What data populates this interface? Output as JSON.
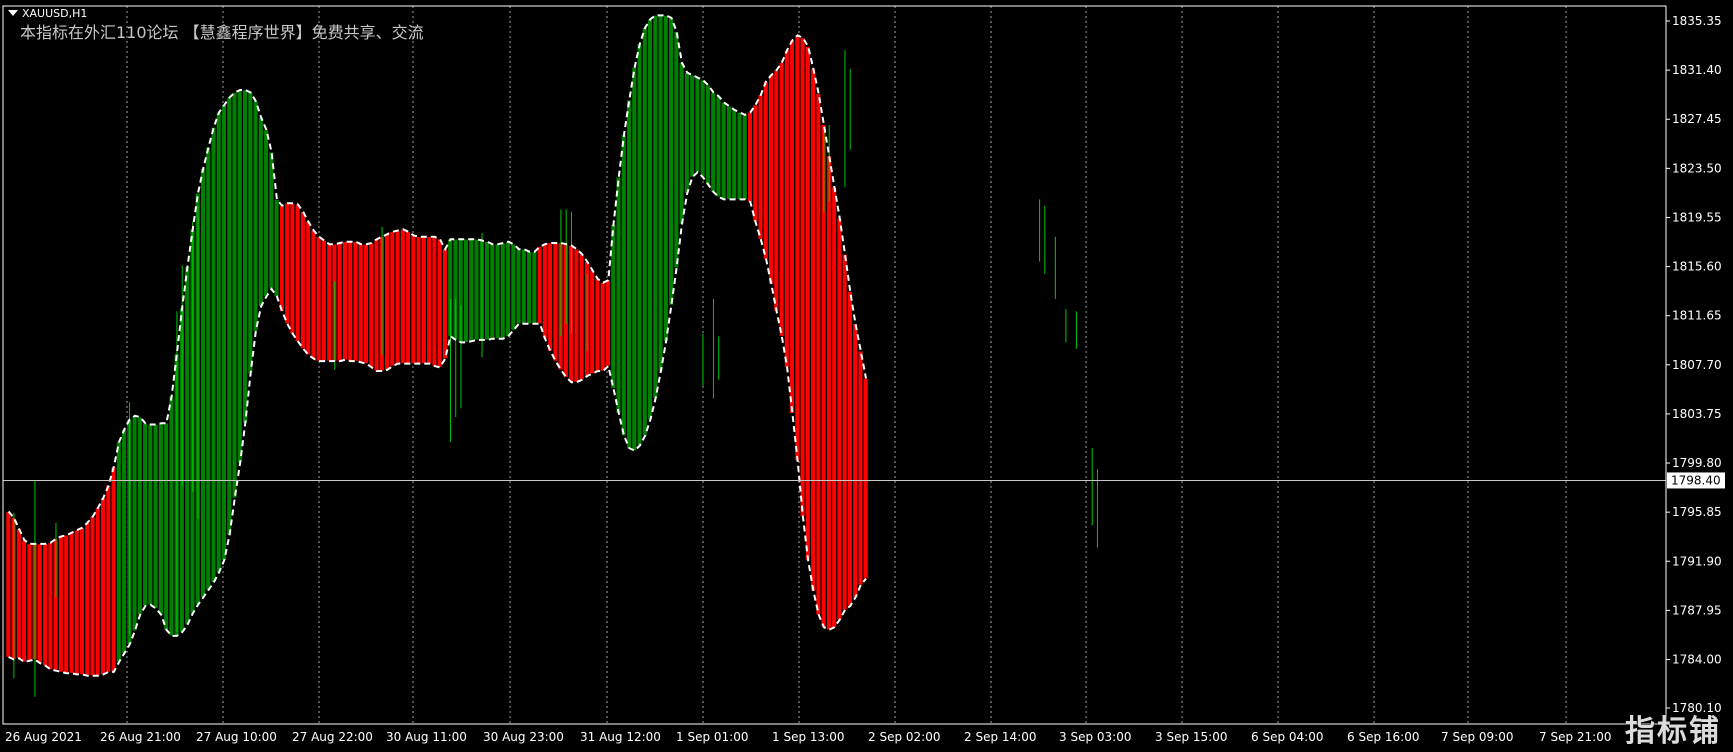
{
  "header": {
    "symbol_label": "XAUUSD,H1",
    "indicator_note": "本指标在外汇110论坛 【慧鑫程序世界】免费共享、交流"
  },
  "watermark": "指标铺",
  "colors": {
    "background": "#000000",
    "axis": "#ffffff",
    "grid": "#c8c8c8",
    "up": "#008000",
    "down": "#ff0000",
    "wick": "#00c800",
    "band_edge": "#ffffff"
  },
  "chart_data": {
    "type": "bar",
    "description_series": "colored band between upper and lower envelope per hourly bar",
    "price_axis": {
      "ticks": [
        "1835.35",
        "1831.40",
        "1827.45",
        "1823.50",
        "1819.55",
        "1815.60",
        "1811.65",
        "1807.70",
        "1803.75",
        "1799.80",
        "1795.85",
        "1791.90",
        "1787.95",
        "1784.00",
        "1780.10"
      ],
      "ylim": [
        1780.1,
        1835.35
      ],
      "current_price": "1798.40"
    },
    "time_axis": {
      "ticks": [
        "26 Aug 2021",
        "26 Aug 21:00",
        "27 Aug 10:00",
        "27 Aug 22:00",
        "30 Aug 11:00",
        "30 Aug 23:00",
        "31 Aug 12:00",
        "1 Sep 01:00",
        "1 Sep 13:00",
        "2 Sep 02:00",
        "2 Sep 14:00",
        "3 Sep 03:00",
        "3 Sep 15:00",
        "6 Sep 04:00",
        "6 Sep 16:00",
        "7 Sep 09:00",
        "7 Sep 21:00"
      ]
    },
    "grid": "vertical-dotted",
    "segments": [
      {
        "color": "down",
        "bars": [
          [
            1795.9,
            1784.2
          ],
          [
            1795.4,
            1784.0
          ],
          [
            1794.5,
            1784.1
          ],
          [
            1793.6,
            1783.8
          ],
          [
            1793.3,
            1783.9
          ],
          [
            1793.3,
            1784.0
          ],
          [
            1793.3,
            1783.7
          ],
          [
            1793.3,
            1783.5
          ],
          [
            1793.4,
            1783.2
          ],
          [
            1793.7,
            1783.1
          ],
          [
            1793.9,
            1783.0
          ],
          [
            1794.0,
            1782.9
          ],
          [
            1794.2,
            1782.9
          ],
          [
            1794.4,
            1782.8
          ],
          [
            1794.6,
            1782.8
          ],
          [
            1795.0,
            1782.7
          ],
          [
            1795.5,
            1782.7
          ],
          [
            1796.2,
            1782.7
          ],
          [
            1797.0,
            1782.8
          ],
          [
            1798.0,
            1783.0
          ],
          [
            1799.5,
            1783.0
          ]
        ]
      },
      {
        "color": "up",
        "bars": [
          [
            1801.5,
            1783.8
          ],
          [
            1802.5,
            1784.5
          ],
          [
            1803.3,
            1785.2
          ],
          [
            1803.6,
            1786.3
          ],
          [
            1803.5,
            1787.6
          ],
          [
            1803.0,
            1788.3
          ],
          [
            1802.9,
            1788.4
          ],
          [
            1802.9,
            1788.1
          ],
          [
            1803.0,
            1787.6
          ],
          [
            1803.0,
            1786.4
          ],
          [
            1805.2,
            1785.9
          ],
          [
            1808.6,
            1785.9
          ],
          [
            1812.3,
            1786.2
          ],
          [
            1815.6,
            1786.8
          ],
          [
            1818.6,
            1787.7
          ],
          [
            1821.5,
            1788.4
          ],
          [
            1823.5,
            1789.0
          ],
          [
            1825.2,
            1789.6
          ],
          [
            1826.8,
            1790.2
          ],
          [
            1828.0,
            1791.0
          ],
          [
            1828.6,
            1792.0
          ],
          [
            1829.2,
            1794.0
          ],
          [
            1829.6,
            1797.0
          ],
          [
            1829.8,
            1799.8
          ],
          [
            1829.8,
            1803.0
          ],
          [
            1829.6,
            1807.0
          ],
          [
            1828.9,
            1810.4
          ],
          [
            1827.6,
            1812.4
          ],
          [
            1826.6,
            1813.2
          ],
          [
            1824.8,
            1813.8
          ],
          [
            1821.0,
            1813.2
          ]
        ]
      },
      {
        "color": "down",
        "bars": [
          [
            1820.5,
            1812.0
          ],
          [
            1820.7,
            1811.0
          ],
          [
            1820.7,
            1810.2
          ],
          [
            1820.6,
            1809.6
          ],
          [
            1820.0,
            1809.0
          ],
          [
            1819.2,
            1808.5
          ],
          [
            1818.5,
            1808.2
          ],
          [
            1818.0,
            1808.0
          ],
          [
            1817.7,
            1808.0
          ],
          [
            1817.4,
            1808.0
          ],
          [
            1817.4,
            1808.0
          ],
          [
            1817.5,
            1808.0
          ],
          [
            1817.6,
            1808.1
          ],
          [
            1817.6,
            1808.0
          ],
          [
            1817.6,
            1808.0
          ],
          [
            1817.4,
            1807.9
          ],
          [
            1817.4,
            1807.8
          ],
          [
            1817.5,
            1807.5
          ],
          [
            1817.8,
            1807.2
          ],
          [
            1818.0,
            1807.2
          ],
          [
            1818.2,
            1807.3
          ],
          [
            1818.4,
            1807.6
          ],
          [
            1818.5,
            1807.8
          ],
          [
            1818.6,
            1807.8
          ],
          [
            1818.4,
            1807.8
          ],
          [
            1818.1,
            1807.8
          ],
          [
            1818.0,
            1807.8
          ],
          [
            1818.0,
            1807.8
          ],
          [
            1818.0,
            1807.8
          ],
          [
            1818.0,
            1807.6
          ],
          [
            1817.8,
            1807.5
          ],
          [
            1817.0,
            1808.2
          ]
        ]
      },
      {
        "color": "up",
        "bars": [
          [
            1817.8,
            1810.0
          ],
          [
            1817.8,
            1809.7
          ],
          [
            1817.8,
            1809.5
          ],
          [
            1817.8,
            1809.5
          ],
          [
            1817.8,
            1809.6
          ],
          [
            1817.8,
            1809.7
          ],
          [
            1817.7,
            1809.7
          ],
          [
            1817.6,
            1809.7
          ],
          [
            1817.4,
            1809.8
          ],
          [
            1817.4,
            1809.8
          ],
          [
            1817.5,
            1809.8
          ],
          [
            1817.6,
            1810.0
          ],
          [
            1817.4,
            1810.5
          ],
          [
            1817.0,
            1811.0
          ],
          [
            1817.0,
            1811.0
          ],
          [
            1816.8,
            1811.0
          ],
          [
            1816.8,
            1811.0
          ]
        ]
      },
      {
        "color": "down",
        "bars": [
          [
            1817.2,
            1811.0
          ],
          [
            1817.4,
            1809.8
          ],
          [
            1817.5,
            1808.8
          ],
          [
            1817.5,
            1808.0
          ],
          [
            1817.5,
            1807.3
          ],
          [
            1817.4,
            1806.7
          ],
          [
            1817.3,
            1806.3
          ],
          [
            1817.0,
            1806.3
          ],
          [
            1816.6,
            1806.5
          ],
          [
            1816.0,
            1806.8
          ],
          [
            1815.3,
            1807.0
          ],
          [
            1814.6,
            1807.2
          ],
          [
            1814.3,
            1807.2
          ],
          [
            1814.5,
            1807.6
          ]
        ]
      },
      {
        "color": "up",
        "bars": [
          [
            1819.0,
            1805.8
          ],
          [
            1822.8,
            1803.8
          ],
          [
            1826.2,
            1802.0
          ],
          [
            1829.0,
            1801.0
          ],
          [
            1831.6,
            1800.8
          ],
          [
            1833.5,
            1801.2
          ],
          [
            1834.8,
            1802.0
          ],
          [
            1835.5,
            1803.3
          ],
          [
            1835.8,
            1805.0
          ],
          [
            1835.8,
            1807.2
          ],
          [
            1835.8,
            1809.6
          ],
          [
            1835.6,
            1812.5
          ],
          [
            1834.5,
            1815.5
          ],
          [
            1832.0,
            1819.0
          ],
          [
            1831.2,
            1821.5
          ],
          [
            1831.0,
            1822.8
          ],
          [
            1830.8,
            1823.2
          ],
          [
            1830.6,
            1822.8
          ],
          [
            1830.2,
            1822.2
          ],
          [
            1829.6,
            1821.6
          ],
          [
            1829.3,
            1821.2
          ],
          [
            1828.8,
            1821.0
          ],
          [
            1828.5,
            1821.0
          ],
          [
            1828.2,
            1821.0
          ],
          [
            1828.0,
            1821.0
          ],
          [
            1827.8,
            1821.0
          ]
        ]
      },
      {
        "color": "down",
        "bars": [
          [
            1828.0,
            1820.8
          ],
          [
            1828.6,
            1819.2
          ],
          [
            1829.4,
            1817.8
          ],
          [
            1830.5,
            1816.2
          ],
          [
            1831.0,
            1814.2
          ],
          [
            1831.4,
            1812.0
          ],
          [
            1832.0,
            1810.0
          ],
          [
            1833.0,
            1807.5
          ],
          [
            1833.8,
            1803.8
          ],
          [
            1834.2,
            1800.0
          ],
          [
            1834.0,
            1795.5
          ],
          [
            1833.3,
            1792.0
          ],
          [
            1831.5,
            1789.5
          ],
          [
            1829.5,
            1787.6
          ],
          [
            1827.0,
            1786.6
          ],
          [
            1824.5,
            1786.4
          ],
          [
            1822.0,
            1786.6
          ],
          [
            1819.5,
            1787.2
          ],
          [
            1816.6,
            1788.0
          ],
          [
            1813.6,
            1788.3
          ],
          [
            1811.0,
            1789.0
          ],
          [
            1808.8,
            1790.0
          ],
          [
            1806.6,
            1790.5
          ]
        ]
      }
    ],
    "wicks": [
      [
        1,
        1795.8,
        1782.5
      ],
      [
        5,
        1798.4,
        1781.0
      ],
      [
        9,
        1795.0,
        1789.0
      ],
      [
        23,
        1804.7,
        1786.0
      ],
      [
        32,
        1812.0,
        1786.2
      ],
      [
        33,
        1815.7,
        1798.0
      ],
      [
        35,
        1819.2,
        1797.5
      ],
      [
        36,
        1820.5,
        1795.3
      ],
      [
        62,
        1814.4,
        1807.3
      ],
      [
        71,
        1818.8,
        1808.5
      ],
      [
        84,
        1813.0,
        1801.5
      ],
      [
        85,
        1813.0,
        1803.5
      ],
      [
        86,
        1812.5,
        1804.2
      ],
      [
        90,
        1818.3,
        1808.3
      ],
      [
        105,
        1820.2,
        1810.0
      ],
      [
        106,
        1820.2,
        1811.0
      ],
      [
        107,
        1820.0,
        1810.2
      ],
      [
        110,
        1815.0,
        1808.8
      ],
      [
        132,
        1810.2,
        1806.0
      ],
      [
        134,
        1813.0,
        1805.0
      ],
      [
        135,
        1810.0,
        1806.5
      ],
      [
        155,
        1826.5,
        1820.0
      ],
      [
        156,
        1827.0,
        1820.8
      ],
      [
        159,
        1833.0,
        1822.0
      ],
      [
        160,
        1831.5,
        1825.0
      ],
      [
        196,
        1821.0,
        1816.0
      ],
      [
        197,
        1820.5,
        1815.0
      ],
      [
        199,
        1818.0,
        1813.0
      ],
      [
        201,
        1812.2,
        1809.5
      ],
      [
        203,
        1812.0,
        1809.0
      ],
      [
        206,
        1801.0,
        1794.8
      ],
      [
        207,
        1799.3,
        1793.0
      ]
    ]
  }
}
